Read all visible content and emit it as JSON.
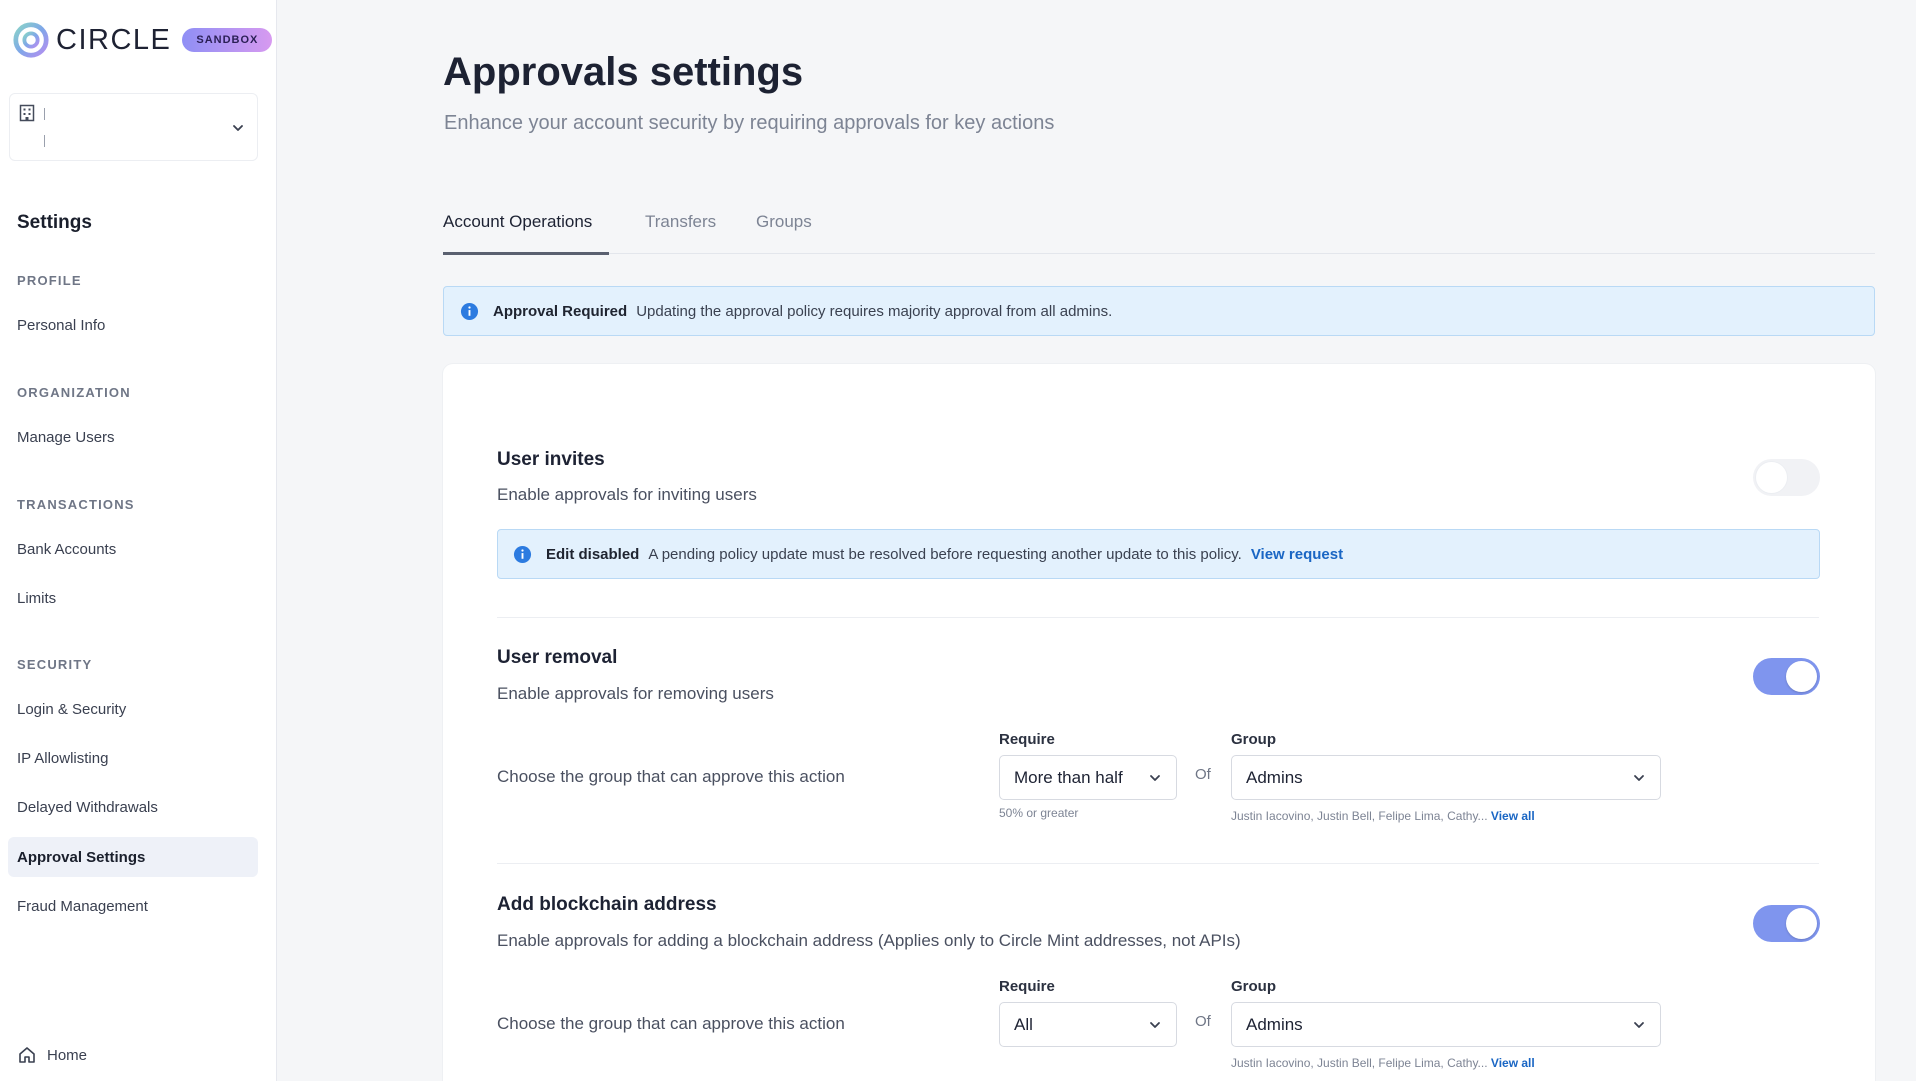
{
  "brand": {
    "name": "CIRCLE",
    "badge": "SANDBOX"
  },
  "sidebar": {
    "title": "Settings",
    "sections": [
      {
        "label": "PROFILE",
        "items": [
          {
            "label": "Personal Info"
          }
        ]
      },
      {
        "label": "ORGANIZATION",
        "items": [
          {
            "label": "Manage Users"
          }
        ]
      },
      {
        "label": "TRANSACTIONS",
        "items": [
          {
            "label": "Bank Accounts"
          },
          {
            "label": "Limits"
          }
        ]
      },
      {
        "label": "SECURITY",
        "items": [
          {
            "label": "Login & Security"
          },
          {
            "label": "IP Allowlisting"
          },
          {
            "label": "Delayed Withdrawals"
          },
          {
            "label": "Approval Settings",
            "active": true
          },
          {
            "label": "Fraud Management"
          }
        ]
      }
    ],
    "home_label": "Home"
  },
  "page": {
    "title": "Approvals settings",
    "subtitle": "Enhance your account security by requiring approvals for key actions"
  },
  "tabs": [
    {
      "label": "Account Operations",
      "active": true
    },
    {
      "label": "Transfers"
    },
    {
      "label": "Groups"
    }
  ],
  "approval_banner": {
    "bold": "Approval Required",
    "text": "Updating the approval policy requires majority approval from all admins."
  },
  "policies": {
    "user_invites": {
      "title": "User invites",
      "description": "Enable approvals for inviting users",
      "enabled": false,
      "banner": {
        "bold": "Edit disabled",
        "text": "A pending policy update must be resolved before requesting another update to this policy.",
        "link": "View request"
      }
    },
    "user_removal": {
      "title": "User removal",
      "description": "Enable approvals for removing users",
      "enabled": true,
      "row_label": "Choose the group that can approve this action",
      "require_label": "Require",
      "require_value": "More than half",
      "require_hint": "50% or greater",
      "of": "Of",
      "group_label": "Group",
      "group_value": "Admins",
      "members": "Justin Iacovino, Justin Bell, Felipe Lima, Cathy...",
      "view_all": "View all"
    },
    "add_blockchain": {
      "title": "Add blockchain address",
      "description": "Enable approvals for adding a blockchain address (Applies only to Circle Mint addresses, not APIs)",
      "enabled": true,
      "row_label": "Choose the group that can approve this action",
      "require_label": "Require",
      "require_value": "All",
      "of": "Of",
      "group_label": "Group",
      "group_value": "Admins",
      "members": "Justin Iacovino, Justin Bell, Felipe Lima, Cathy...",
      "view_all": "View all"
    }
  },
  "colors": {
    "accent": "#7f95ee",
    "link": "#1a66c4",
    "info_bg": "#e3f1fd",
    "info_border": "#b9d9f5",
    "badge_gradient_start": "#8f8ff5",
    "badge_gradient_end": "#d79af0"
  }
}
